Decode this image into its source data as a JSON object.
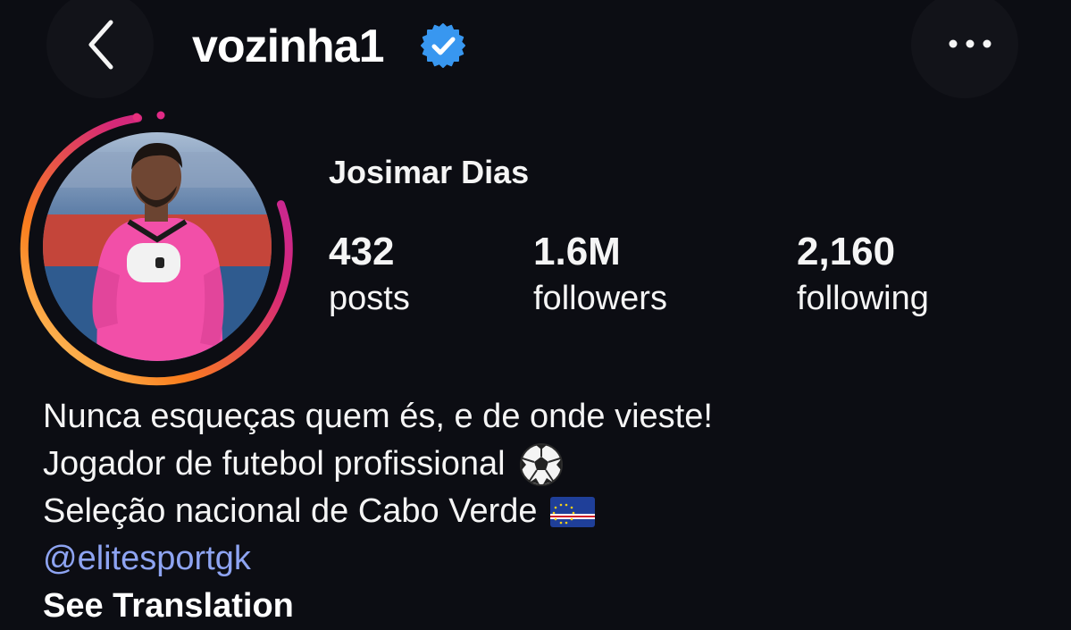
{
  "header": {
    "username": "vozinha1",
    "back_icon": "chevron-left-icon",
    "verified_icon": "verified-badge-icon",
    "more_icon": "more-horizontal-icon",
    "verified_color": "#3897f0"
  },
  "profile": {
    "full_name": "Josimar Dias",
    "avatar": "profile-photo",
    "story_ring_colors": [
      "#feda75",
      "#fa7e1e",
      "#d62976",
      "#962fbf"
    ]
  },
  "stats": [
    {
      "value": "432",
      "label": "posts"
    },
    {
      "value": "1.6M",
      "label": "followers"
    },
    {
      "value": "2,160",
      "label": "following"
    }
  ],
  "bio": {
    "line1": "Nunca esqueças quem és, e de onde vieste!",
    "line2": "Jogador de futebol profissional",
    "line2_emoji": "soccer-ball-icon",
    "line3": "Seleção nacional de Cabo Verde",
    "line3_emoji": "cape-verde-flag-icon",
    "link": "@elitesportgk",
    "link_color": "#8ea4f2",
    "translate_label": "See Translation"
  }
}
